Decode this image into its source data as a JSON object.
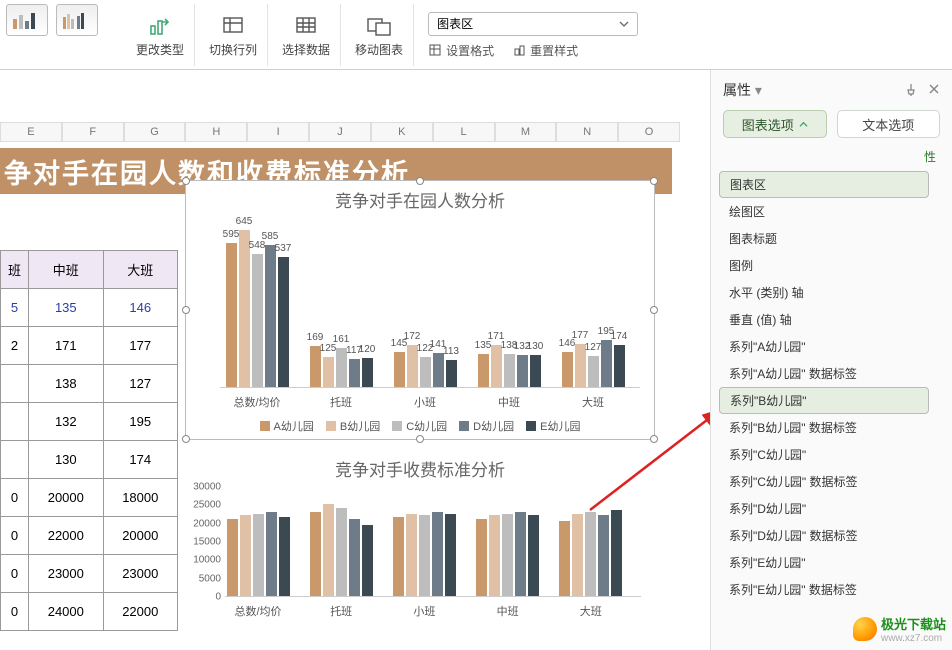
{
  "ribbon": {
    "change_type": "更改类型",
    "switch_rowcol": "切换行列",
    "select_data": "选择数据",
    "move_chart": "移动图表",
    "selector_value": "图表区",
    "set_format": "设置格式",
    "reset_style": "重置样式"
  },
  "columns": [
    "E",
    "F",
    "G",
    "H",
    "I",
    "J",
    "K",
    "L",
    "M",
    "N",
    "O"
  ],
  "banner_title": "争对手在园人数和收费标准分析",
  "table": {
    "headers": [
      "班",
      "中班",
      "大班"
    ],
    "rows": [
      [
        "5",
        "135",
        "146"
      ],
      [
        "2",
        "171",
        "177"
      ],
      [
        "",
        "138",
        "127"
      ],
      [
        "",
        "132",
        "195"
      ],
      [
        "",
        "130",
        "174"
      ],
      [
        "0",
        "20000",
        "18000"
      ],
      [
        "0",
        "22000",
        "20000"
      ],
      [
        "0",
        "23000",
        "23000"
      ],
      [
        "0",
        "24000",
        "22000"
      ]
    ]
  },
  "panel": {
    "title": "属性",
    "tab_chart": "图表选项",
    "tab_text": "文本选项",
    "sub": "性",
    "items": [
      "图表区",
      "绘图区",
      "图表标题",
      "图例",
      "水平 (类别) 轴",
      "垂直 (值) 轴",
      "系列\"A幼儿园\"",
      "系列\"A幼儿园\" 数据标签",
      "系列\"B幼儿园\"",
      "系列\"B幼儿园\" 数据标签",
      "系列\"C幼儿园\"",
      "系列\"C幼儿园\" 数据标签",
      "系列\"D幼儿园\"",
      "系列\"D幼儿园\" 数据标签",
      "系列\"E幼儿园\"",
      "系列\"E幼儿园\" 数据标签"
    ],
    "selected_a": 0,
    "selected_b": 8
  },
  "watermark": "极光下载站",
  "watermark_url": "www.xz7.com",
  "chart_data": [
    {
      "type": "bar",
      "title": "竞争对手在园人数分析",
      "categories": [
        "总数/均价",
        "托班",
        "小班",
        "中班",
        "大班"
      ],
      "series": [
        {
          "name": "A幼儿园",
          "color": "#c9996b",
          "values": [
            595,
            169,
            145,
            135,
            146
          ]
        },
        {
          "name": "B幼儿园",
          "color": "#e0c1a5",
          "values": [
            645,
            125,
            172,
            171,
            177
          ]
        },
        {
          "name": "C幼儿园",
          "color": "#bdbdbd",
          "values": [
            548,
            161,
            122,
            138,
            127
          ]
        },
        {
          "name": "D幼儿园",
          "color": "#6e7b88",
          "values": [
            585,
            117,
            141,
            132,
            195
          ]
        },
        {
          "name": "E幼儿园",
          "color": "#3b4a52",
          "values": [
            537,
            120,
            113,
            130,
            174
          ]
        }
      ],
      "ylim": [
        0,
        700
      ],
      "data_labels": true
    },
    {
      "type": "bar",
      "title": "竞争对手收费标准分析",
      "categories": [
        "总数/均价",
        "托班",
        "小班",
        "中班",
        "大班"
      ],
      "series": [
        {
          "name": "A幼儿园",
          "color": "#c9996b",
          "values": [
            21000,
            23000,
            21500,
            21000,
            20500
          ]
        },
        {
          "name": "B幼儿园",
          "color": "#e0c1a5",
          "values": [
            22000,
            25000,
            22500,
            22000,
            22500
          ]
        },
        {
          "name": "C幼儿园",
          "color": "#bdbdbd",
          "values": [
            22500,
            24000,
            22000,
            22500,
            23000
          ]
        },
        {
          "name": "D幼儿园",
          "color": "#6e7b88",
          "values": [
            23000,
            21000,
            23000,
            23000,
            22000
          ]
        },
        {
          "name": "E幼儿园",
          "color": "#3b4a52",
          "values": [
            21500,
            19500,
            22500,
            22000,
            23500
          ]
        }
      ],
      "yticks": [
        0,
        5000,
        10000,
        15000,
        20000,
        25000,
        30000
      ],
      "ylim": [
        0,
        30000
      ]
    }
  ]
}
